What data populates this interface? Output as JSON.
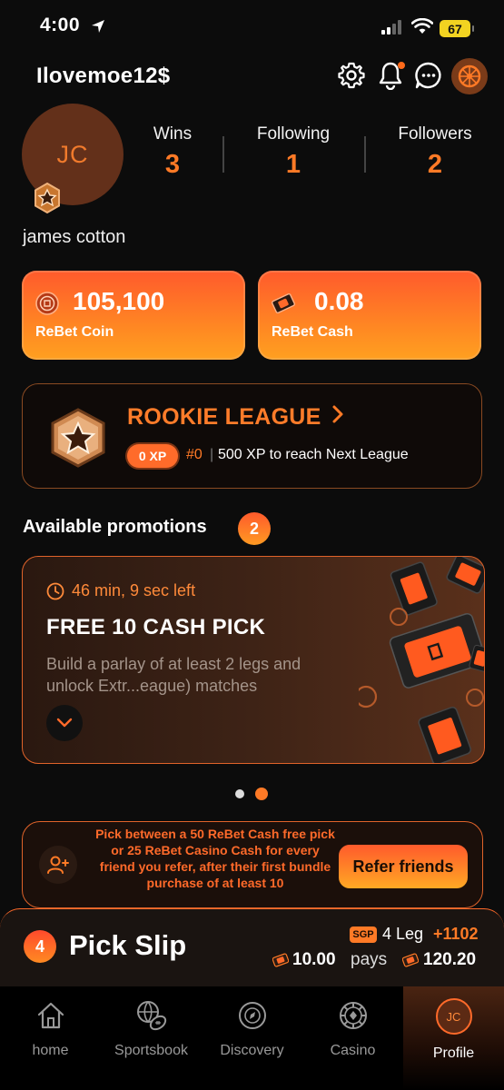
{
  "status": {
    "time": "4:00",
    "battery": "67"
  },
  "header": {
    "username": "Ilovemoe12$"
  },
  "profile": {
    "initials": "JC",
    "display_name": "james cotton",
    "stats": [
      {
        "label": "Wins",
        "value": "3"
      },
      {
        "label": "Following",
        "value": "1"
      },
      {
        "label": "Followers",
        "value": "2"
      }
    ]
  },
  "balances": {
    "coin": {
      "value": "105,100",
      "label": "ReBet Coin"
    },
    "cash": {
      "value": "0.08",
      "label": "ReBet Cash"
    }
  },
  "league": {
    "title": "ROOKIE LEAGUE",
    "xp": "0 XP",
    "rank": "#0",
    "separator": "|",
    "next": "500 XP to reach Next League"
  },
  "promotions": {
    "heading": "Available promotions",
    "count": "2",
    "card": {
      "timer": "46 min, 9 sec left",
      "title": "FREE 10 CASH PICK",
      "description": "Build a parlay of at least 2 legs and unlock Extr...eague) matches"
    }
  },
  "referral": {
    "text": "Pick between a 50 ReBet Cash free pick or 25 ReBet Casino Cash for every friend you refer, after their first bundle purchase of at least 10",
    "button": "Refer friends"
  },
  "pick_slip": {
    "count": "4",
    "title": "Pick Slip",
    "tag": "SGP",
    "legs": "4 Leg",
    "odds": "+1102",
    "stake": "10.00",
    "pays_label": "pays",
    "payout": "120.20"
  },
  "nav": {
    "items": [
      {
        "label": "home",
        "icon": "home-icon"
      },
      {
        "label": "Sportsbook",
        "icon": "sports-balls-icon"
      },
      {
        "label": "Discovery",
        "icon": "compass-icon"
      },
      {
        "label": "Casino",
        "icon": "casino-chip-icon"
      },
      {
        "label": "Profile",
        "icon": "avatar",
        "initials": "JC"
      }
    ]
  },
  "colors": {
    "accent": "#ff7a26",
    "background": "#0c0c0c"
  }
}
